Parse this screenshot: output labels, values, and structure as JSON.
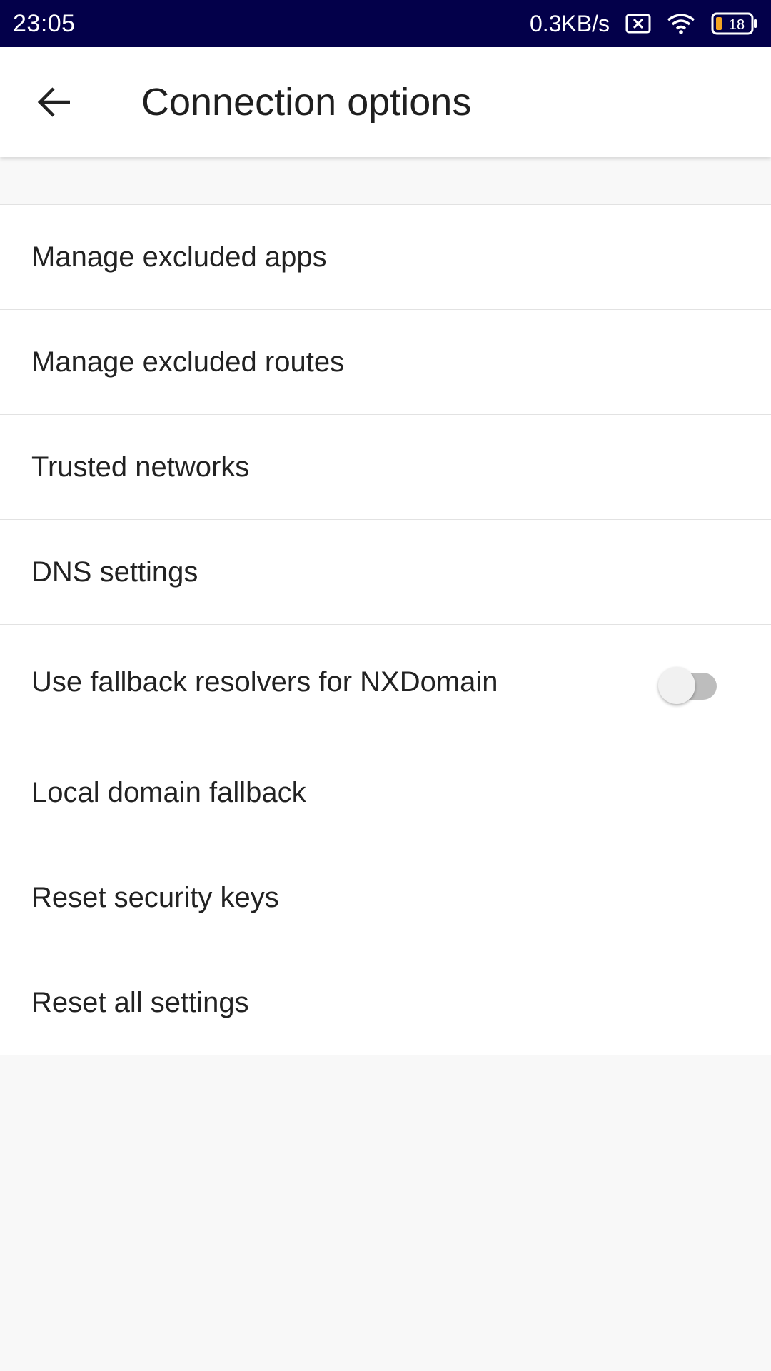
{
  "status_bar": {
    "time": "23:05",
    "net_speed": "0.3KB/s",
    "battery_level": "18",
    "icons": [
      "sim-error-icon",
      "wifi-icon",
      "battery-icon"
    ]
  },
  "app_bar": {
    "back_icon": "arrow-left-icon",
    "title": "Connection options"
  },
  "settings": {
    "items": [
      {
        "label": "Manage excluded apps"
      },
      {
        "label": "Manage excluded routes"
      },
      {
        "label": "Trusted networks"
      },
      {
        "label": "DNS settings"
      },
      {
        "label": "Use fallback resolvers for NXDomain",
        "toggle": false
      },
      {
        "label": "Local domain fallback"
      },
      {
        "label": "Reset security keys"
      },
      {
        "label": "Reset all settings"
      }
    ]
  },
  "colors": {
    "status_bar": "#03004a",
    "background": "#f8f8f8",
    "battery_fill": "#f5a623"
  }
}
